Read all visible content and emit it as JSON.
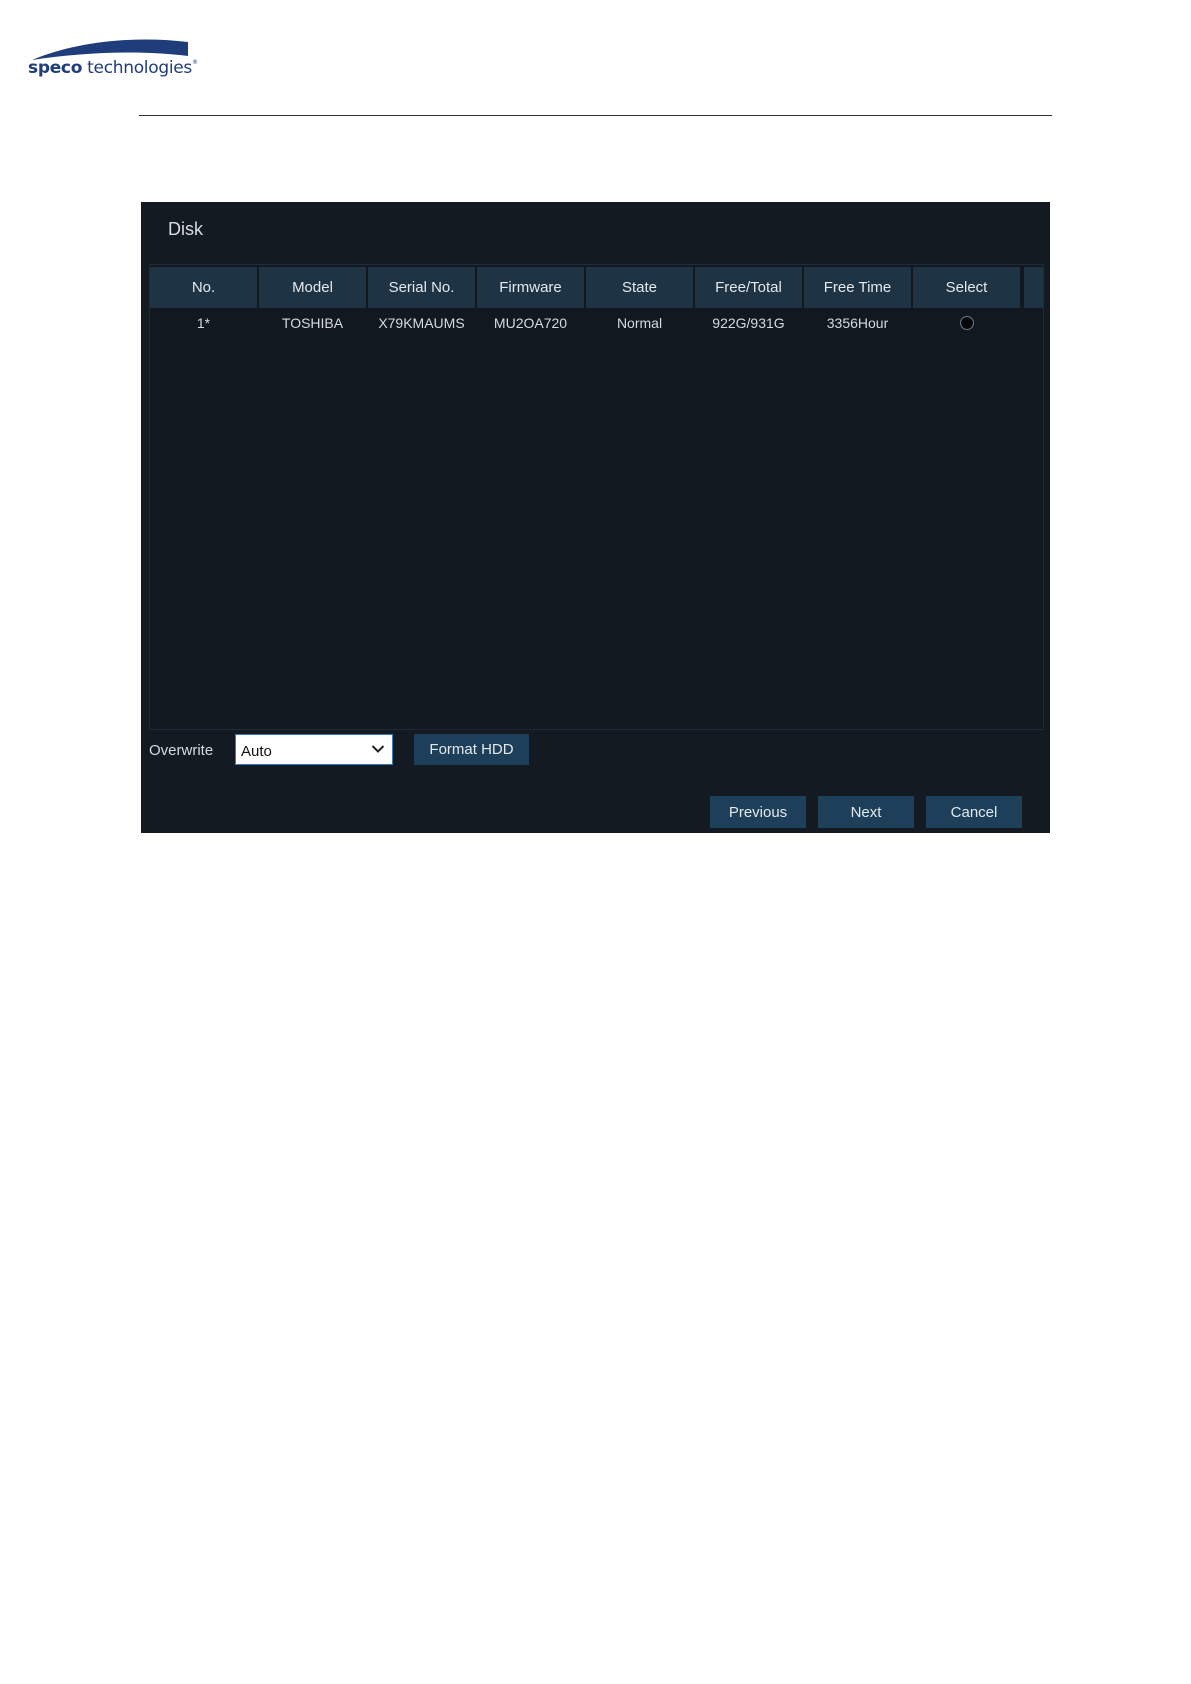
{
  "header": {
    "logo_text_bold": "speco",
    "logo_text_rest": " technologies",
    "logo_mark": "®"
  },
  "window": {
    "title": "Disk"
  },
  "table": {
    "columns": [
      "No.",
      "Model",
      "Serial No.",
      "Firmware",
      "State",
      "Free/Total",
      "Free Time",
      "Select"
    ],
    "rows": [
      {
        "no": "1*",
        "model": "TOSHIBA",
        "serial": "X79KMAUMS",
        "firmware": "MU2OA720",
        "state": "Normal",
        "free_total": "922G/931G",
        "free_time": "3356Hour",
        "selected": false
      }
    ]
  },
  "overwrite": {
    "label": "Overwrite",
    "value": "Auto"
  },
  "buttons": {
    "format": "Format HDD",
    "previous": "Previous",
    "next": "Next",
    "cancel": "Cancel"
  },
  "colors": {
    "panel_bg": "#131a21",
    "header_bg": "#1e3445",
    "button_bg": "#1e3f5a",
    "logo_blue": "#1f3d7a"
  },
  "icons": {
    "dropdown": "chevron-down-icon",
    "radio": "radio-button"
  }
}
